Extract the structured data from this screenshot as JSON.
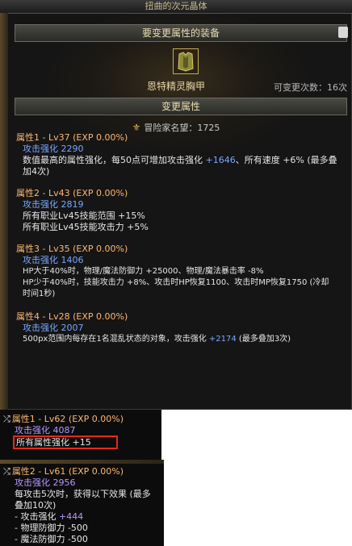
{
  "window": {
    "title": "扭曲的次元晶体",
    "section_equipment": "要变更属性的装备",
    "section_change": "变更属性",
    "equipment_name": "恩特精灵胸甲",
    "equipment_icon": "chest-armor-icon",
    "changes_label": "可变更次数：16次",
    "fame_icon": "fame-emblem-icon",
    "fame_text": "冒险家名望：1725"
  },
  "attributes": [
    {
      "title": "属性1 - Lv37 (EXP 0.00%)",
      "stat_label": "攻击强化",
      "stat_value": "2290",
      "line1_a": "数值最高的属性强化，每50点可增加攻击强化",
      "line1_b": "+1646",
      "line1_c": "、所有速度 +6% (最多叠",
      "line2": "加4次)"
    },
    {
      "title": "属性2 - Lv43 (EXP 0.00%)",
      "stat_label": "攻击强化",
      "stat_value": "2819",
      "line1": "所有职业Lv45技能范围 +15%",
      "line2": "所有职业Lv45技能攻击力 +5%"
    },
    {
      "title": "属性3 - Lv35 (EXP 0.00%)",
      "stat_label": "攻击强化",
      "stat_value": "1406",
      "line1": "HP大于40%时，物理/魔法防御力 +25000、物理/魔法暴击率 -8%",
      "line2": "HP少于40%时，技能攻击力 +8%、攻击时HP恢复1100、攻击时MP恢复1750 (冷却",
      "line3": "时间1秒)"
    },
    {
      "title": "属性4 - Lv28 (EXP 0.00%)",
      "stat_label": "攻击强化",
      "stat_value": "2007",
      "line1_a": "500px范围内每存在1名混乱状态的对象，攻击强化",
      "line1_b": "+2174",
      "line1_c": "(最多叠加3次)"
    }
  ],
  "popup1": {
    "title": "属性1 - Lv62 (EXP 0.00%)",
    "stat_label": "攻击强化",
    "stat_value": "4087",
    "effect_label": "所有属性强化",
    "effect_value": "+15"
  },
  "popup2": {
    "title": "属性2 - Lv61 (EXP 0.00%)",
    "stat_label": "攻击强化",
    "stat_value": "2956",
    "desc1": "每攻击5次时，获得以下效果 (最多",
    "desc2": "叠加10次)",
    "bullet1_label": "- 攻击强化",
    "bullet1_value": "+444",
    "bullet2": "- 物理防御力 -500",
    "bullet3": "- 魔法防御力 -500"
  },
  "colors": {
    "attr_title": "#ffb870",
    "stat_blue": "#77a8ff",
    "stat_purple": "#b596ff",
    "highlight": "#e52a1a"
  }
}
